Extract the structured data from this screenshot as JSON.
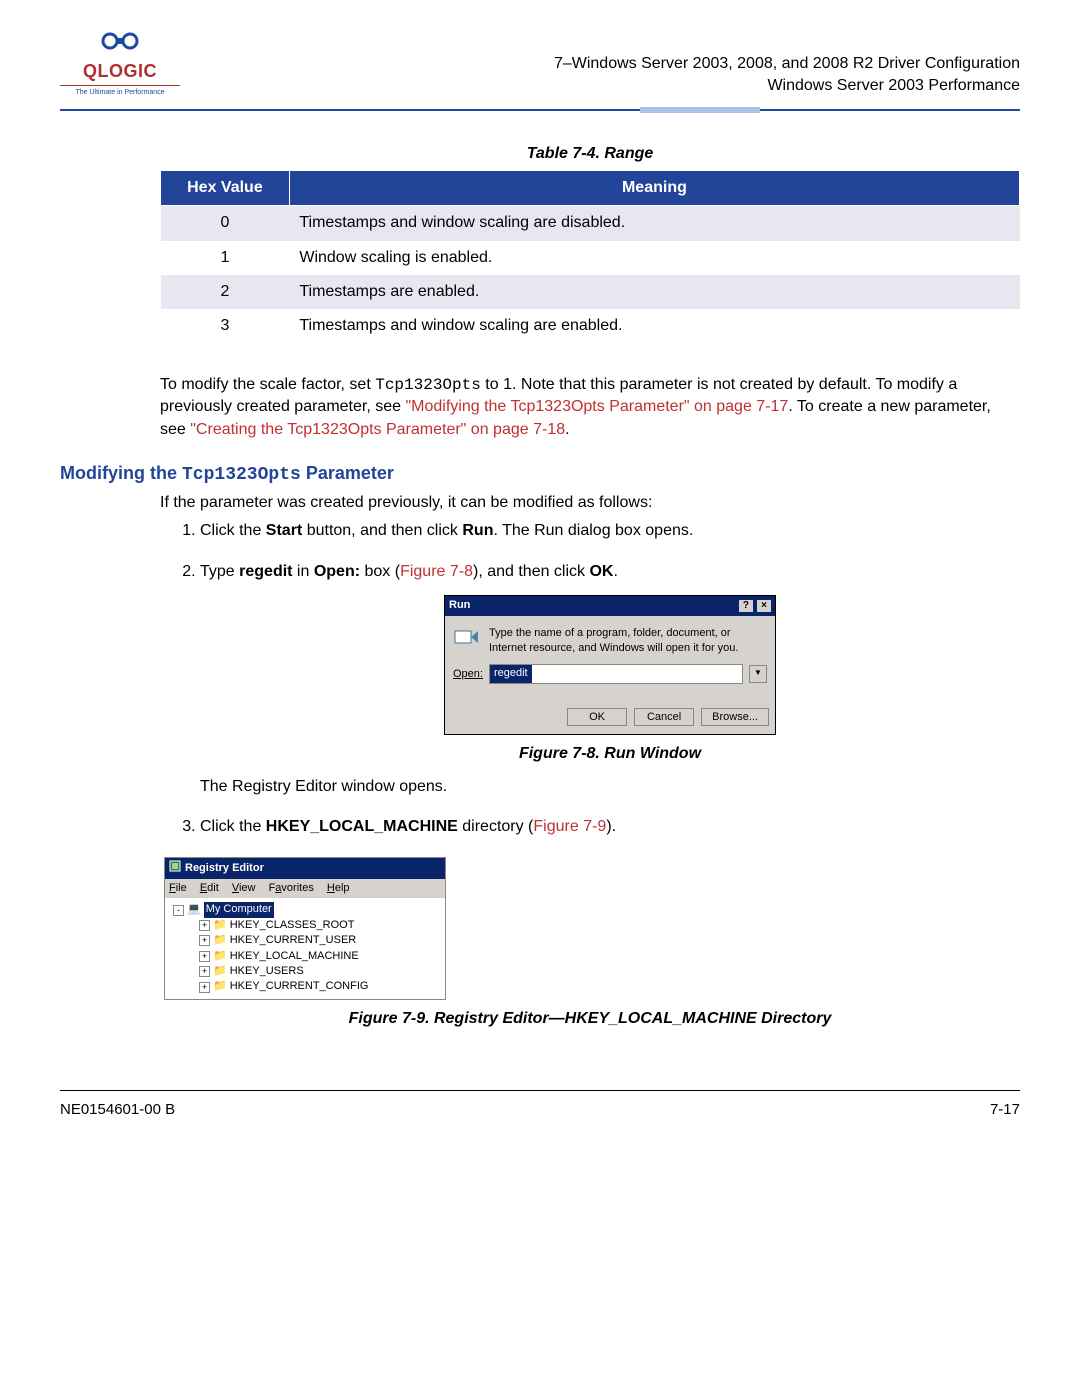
{
  "logo": {
    "name": "QLOGIC",
    "tagline": "The Ultimate in Performance"
  },
  "header": {
    "line1": "7–Windows Server 2003, 2008, and 2008 R2 Driver Configuration",
    "line2": "Windows Server 2003 Performance"
  },
  "table": {
    "caption": "Table 7-4. Range",
    "headers": [
      "Hex Value",
      "Meaning"
    ],
    "rows": [
      {
        "hex": "0",
        "meaning": "Timestamps and window scaling are disabled."
      },
      {
        "hex": "1",
        "meaning": "Window scaling is enabled."
      },
      {
        "hex": "2",
        "meaning": "Timestamps are enabled."
      },
      {
        "hex": "3",
        "meaning": "Timestamps and window scaling are enabled."
      }
    ]
  },
  "para1": {
    "t1": "To modify the scale factor, set ",
    "code": "Tcp1323Opts",
    "t2": " to 1. Note that this parameter is not created by default. To modify a previously created parameter, see ",
    "link1": "\"Modifying the Tcp1323Opts Parameter\" on page 7-17",
    "t3": ". To create a new parameter, see ",
    "link2": "\"Creating the Tcp1323Opts Parameter\" on page 7-18",
    "t4": "."
  },
  "section": {
    "heading_pre": "Modifying the ",
    "heading_code": "Tcp1323Opts",
    "heading_post": " Parameter",
    "intro": "If the parameter was created previously, it can be modified as follows:",
    "step1": {
      "a": "Click the ",
      "b": "Start",
      "c": " button, and then click ",
      "d": "Run",
      "e": ". The Run dialog box opens."
    },
    "step2": {
      "a": "Type ",
      "b": "regedit",
      "c": " in ",
      "d": "Open:",
      "e": " box (",
      "link": "Figure 7-8",
      "f": "), and then click ",
      "g": "OK",
      "h": "."
    },
    "fig8": "Figure 7-8.  Run Window",
    "after_step2": "The Registry Editor window opens.",
    "step3": {
      "a": "Click the ",
      "b": "HKEY_LOCAL_MACHINE",
      "c": " directory (",
      "link": "Figure 7-9",
      "d": ")."
    },
    "fig9": "Figure 7-9.  Registry Editor—HKEY_LOCAL_MACHINE Directory"
  },
  "run_dialog": {
    "title": "Run",
    "desc": "Type the name of a program, folder, document, or Internet resource, and Windows will open it for you.",
    "open_label": "Open:",
    "value": "regedit",
    "ok": "OK",
    "cancel": "Cancel",
    "browse": "Browse..."
  },
  "reg": {
    "title": "Registry Editor",
    "menu": [
      "File",
      "Edit",
      "View",
      "Favorites",
      "Help"
    ],
    "root": "My Computer",
    "keys": [
      "HKEY_CLASSES_ROOT",
      "HKEY_CURRENT_USER",
      "HKEY_LOCAL_MACHINE",
      "HKEY_USERS",
      "HKEY_CURRENT_CONFIG"
    ]
  },
  "footer": {
    "left": "NE0154601-00  B",
    "right": "7-17"
  }
}
